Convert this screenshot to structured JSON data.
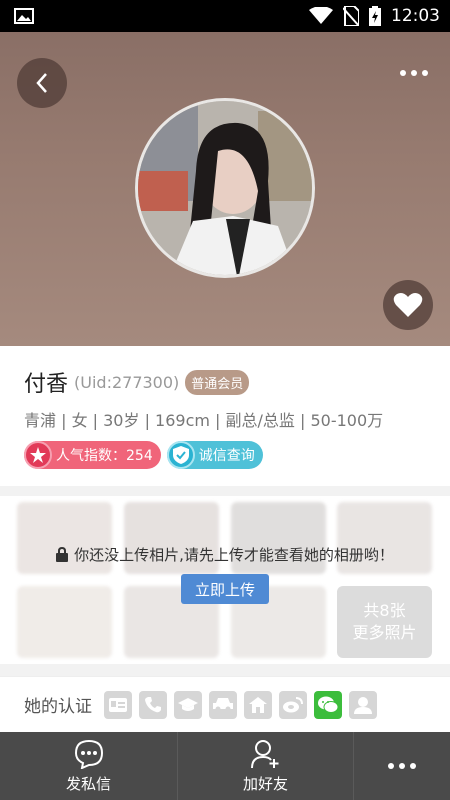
{
  "status_bar": {
    "time": "12:03"
  },
  "profile": {
    "name": "付香",
    "uid": "(Uid:277300)",
    "member_badge": "普通会员",
    "info": "青浦 | 女 | 30岁 | 169cm | 副总/总监 | 50-100万",
    "popularity": "人气指数：254",
    "credit_check": "诚信查询"
  },
  "gallery": {
    "lock_message": "你还没上传相片,请先上传才能查看她的相册哟！",
    "upload_button": "立即上传",
    "more_count": "共8张",
    "more_label": "更多照片"
  },
  "certs": {
    "label": "她的认证",
    "icons": [
      "id-card-icon",
      "phone-icon",
      "education-icon",
      "car-icon",
      "house-icon",
      "weibo-icon",
      "wechat-icon",
      "person-icon"
    ]
  },
  "bottom_bar": {
    "message": "发私信",
    "add_friend": "加好友"
  },
  "colors": {
    "accent_blue": "#4f8ad4",
    "member_brown": "#b89a88",
    "popularity_pink": "#f0657a",
    "credit_cyan": "#4fc1d8",
    "wechat_green": "#3cbd3c"
  }
}
